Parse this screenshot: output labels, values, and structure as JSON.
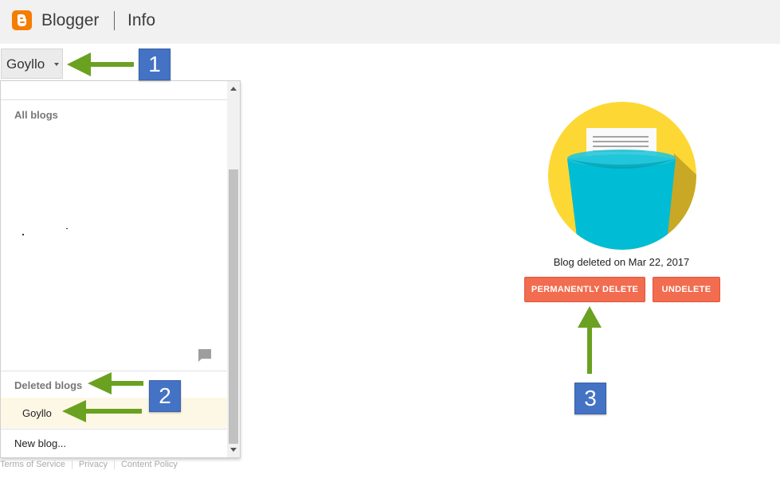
{
  "header": {
    "brand": "Blogger",
    "page_title": "Info"
  },
  "blog_selector": {
    "current": "Goyllo"
  },
  "dropdown": {
    "all_blogs_label": "All blogs",
    "deleted_blogs_label": "Deleted blogs",
    "deleted_items": [
      "Goyllo"
    ],
    "new_blog": "New blog..."
  },
  "footer": {
    "links": [
      "Terms of Service",
      "Privacy",
      "Content Policy"
    ]
  },
  "main": {
    "status_text": "Blog deleted on Mar 22, 2017",
    "permanently_delete": "PERMANENTLY DELETE",
    "undelete": "UNDELETE"
  },
  "annotations": {
    "badges": [
      "1",
      "2",
      "3"
    ]
  },
  "colors": {
    "brand_orange": "#f57d00",
    "button": "#f26c4f",
    "badge": "#4472c4",
    "arrow": "#6aa121",
    "bin": "#00bcd4",
    "circle": "#fdd835"
  }
}
